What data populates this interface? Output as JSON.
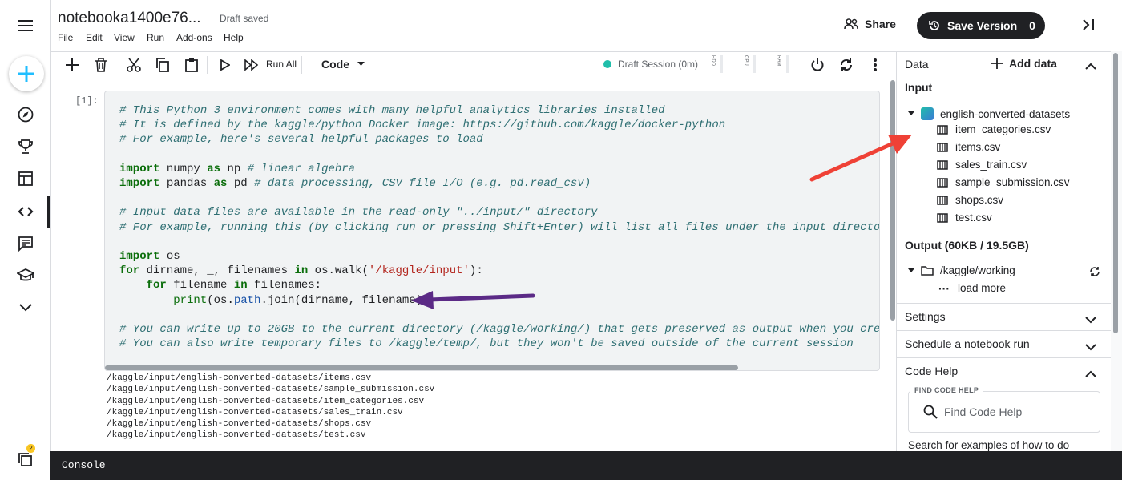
{
  "header": {
    "title": "notebooka1400e76...",
    "draft_status": "Draft saved",
    "menu": [
      "File",
      "Edit",
      "View",
      "Run",
      "Add-ons",
      "Help"
    ],
    "share_label": "Share",
    "save_version_label": "Save Version",
    "save_version_count": "0"
  },
  "rail": {
    "icons": [
      "menu-icon",
      "add-icon",
      "compass-icon",
      "trophy-icon",
      "table-icon",
      "code-icon",
      "comment-icon",
      "school-icon",
      "chevron-down-icon",
      "notifications-icon"
    ],
    "notification_badge": "2"
  },
  "toolbar": {
    "run_all_label": "Run All",
    "cell_type": "Code",
    "session_label": "Draft Session (0m)",
    "meters": [
      "HDD",
      "CPU",
      "RAM"
    ]
  },
  "cell": {
    "prompt": "[1]:",
    "output_lines": [
      "/kaggle/input/english-converted-datasets/items.csv",
      "/kaggle/input/english-converted-datasets/sample_submission.csv",
      "/kaggle/input/english-converted-datasets/item_categories.csv",
      "/kaggle/input/english-converted-datasets/sales_train.csv",
      "/kaggle/input/english-converted-datasets/shops.csv",
      "/kaggle/input/english-converted-datasets/test.csv"
    ]
  },
  "panel": {
    "data_label": "Data",
    "add_data_label": "Add data",
    "input_heading": "Input",
    "dataset_name": "english-converted-datasets",
    "files": [
      "item_categories.csv",
      "items.csv",
      "sales_train.csv",
      "sample_submission.csv",
      "shops.csv",
      "test.csv"
    ],
    "output_heading": "Output (60KB / 19.5GB)",
    "working_dir": "/kaggle/working",
    "load_more": "load more",
    "settings_label": "Settings",
    "schedule_label": "Schedule a notebook run",
    "code_help_label": "Code Help",
    "find_code_help_label": "FIND CODE HELP",
    "find_code_help_placeholder": "Find Code Help",
    "search_hint": "Search for examples of how to do"
  },
  "console": {
    "label": "Console"
  },
  "colors": {
    "accent": "#20beaa",
    "arrow_red": "#ef4136",
    "arrow_purple": "#5b2a86",
    "dark": "#202124"
  }
}
